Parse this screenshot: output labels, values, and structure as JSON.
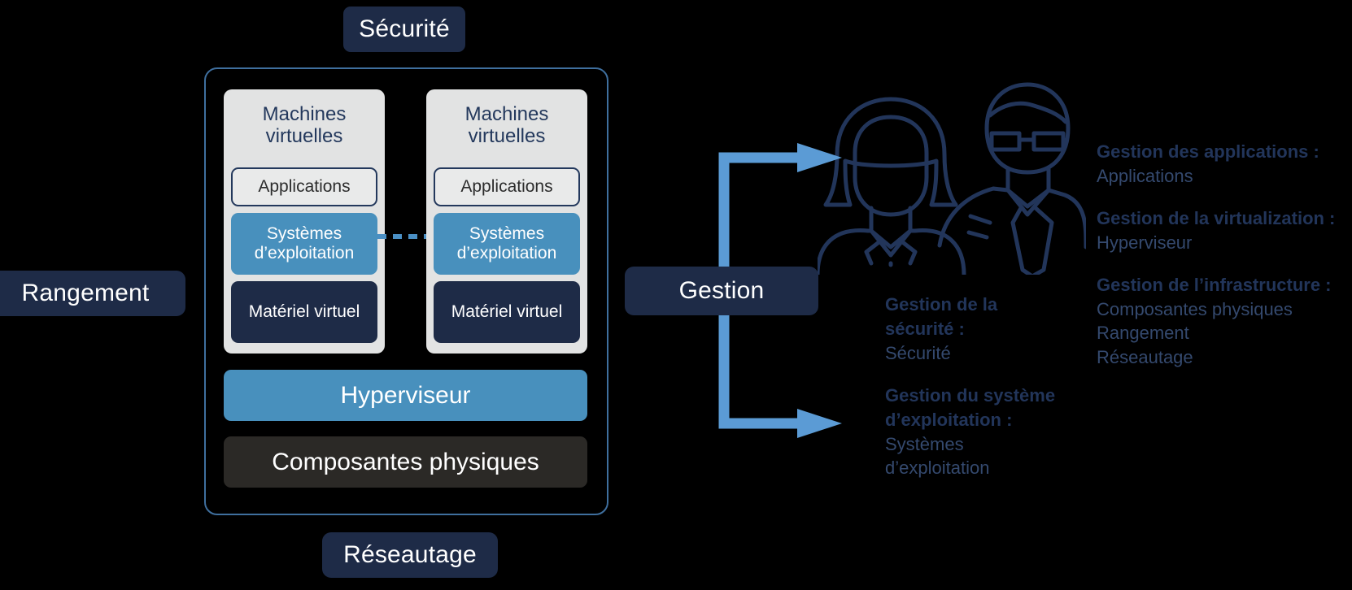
{
  "colors": {
    "background": "#000000",
    "navy_chip": "#1e2b47",
    "accent_blue": "#4890bd",
    "arrow_blue": "#5b9bd5",
    "container_border": "#3f6f9e",
    "vm_panel": "#e2e3e3",
    "physical_bar": "#2b2926",
    "label_text": "#22355a",
    "value_text": "#34496e",
    "illustration_stroke": "#22355a"
  },
  "chips": {
    "security": "Sécurité",
    "storage": "Rangement",
    "networking": "Réseautage",
    "management": "Gestion"
  },
  "host_stack": {
    "vm_columns": [
      {
        "title": "Machines virtuelles",
        "layers": [
          {
            "name": "applications",
            "label": "Applications"
          },
          {
            "name": "operating-systems",
            "label": "Systèmes d’exploitation"
          },
          {
            "name": "virtual-hardware",
            "label": "Matériel virtuel"
          }
        ]
      },
      {
        "title": "Machines virtuelles",
        "layers": [
          {
            "name": "applications",
            "label": "Applications"
          },
          {
            "name": "operating-systems",
            "label": "Systèmes d’exploitation"
          },
          {
            "name": "virtual-hardware",
            "label": "Matériel virtuel"
          }
        ]
      }
    ],
    "hypervisor": "Hyperviseur",
    "physical_components": "Composantes physiques"
  },
  "mapping": {
    "left_column": [
      {
        "name": "security-management",
        "label": "Gestion de la sécurité :",
        "value": "Sécurité"
      },
      {
        "name": "operating-system-management",
        "label": "Gestion du système d’exploitation :",
        "value": "Systèmes d’exploitation"
      }
    ],
    "right_column": [
      {
        "name": "application-management",
        "label": "Gestion des applications :",
        "value": "Applications"
      },
      {
        "name": "virtualization-management",
        "label": "Gestion de la virtualization :",
        "value": "Hyperviseur"
      },
      {
        "name": "infrastructure-management",
        "label": "Gestion de l’infrastructure :",
        "value": "Composantes physiques\nRangement\nRéseautage"
      }
    ]
  },
  "icons": {
    "people": "two-people-icon",
    "arrow_top": "arrow-elbow-up-right-icon",
    "arrow_bottom": "arrow-elbow-down-right-icon",
    "os_link": "dashed-connector-icon"
  }
}
